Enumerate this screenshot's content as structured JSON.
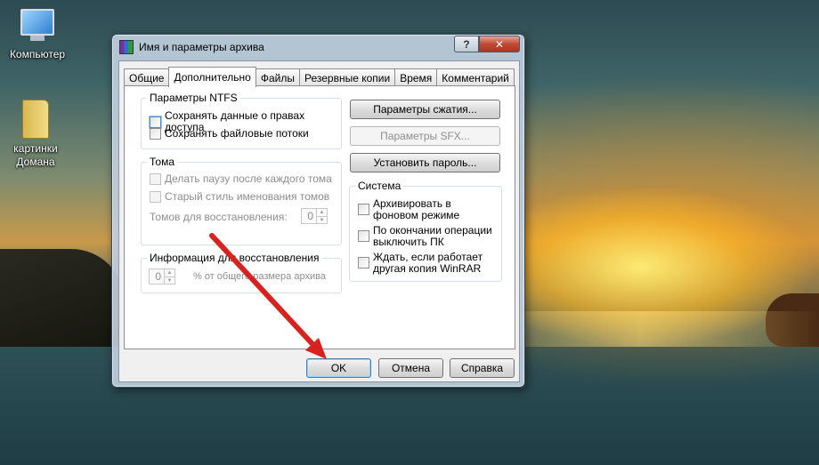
{
  "desktop": {
    "icons": [
      {
        "label": "Компьютер",
        "icon": "computer-icon"
      },
      {
        "label": "картинки Домана",
        "icon": "folder-icon"
      }
    ]
  },
  "dialog": {
    "title": "Имя и параметры архива",
    "help_label": "?",
    "close_label": "✕",
    "tabs": [
      {
        "label": "Общие",
        "active": false
      },
      {
        "label": "Дополнительно",
        "active": true
      },
      {
        "label": "Файлы",
        "active": false
      },
      {
        "label": "Резервные копии",
        "active": false
      },
      {
        "label": "Время",
        "active": false
      },
      {
        "label": "Комментарий",
        "active": false
      }
    ],
    "ntfs": {
      "title": "Параметры NTFS",
      "save_access_rights": "Сохранять данные о правах доступа",
      "save_file_streams": "Сохранять файловые потоки"
    },
    "volumes": {
      "title": "Тома",
      "pause_after_volume": "Делать паузу после каждого тома",
      "old_naming_style": "Старый стиль именования томов",
      "recovery_volumes_label": "Томов для восстановления:",
      "recovery_volumes_value": "0"
    },
    "recovery": {
      "title": "Информация для восстановления",
      "value": "0",
      "unit_label": "% от общего размера архива"
    },
    "buttons": {
      "compression_params": "Параметры сжатия...",
      "sfx_params": "Параметры SFX...",
      "set_password": "Установить пароль..."
    },
    "system": {
      "title": "Система",
      "background_archiving": "Архивировать в фоновом режиме",
      "shutdown_when_done": "По окончании операции выключить ПК",
      "wait_other_copy": "Ждать, если работает другая копия WinRAR"
    },
    "footer": {
      "ok": "OK",
      "cancel": "Отмена",
      "help": "Справка"
    }
  },
  "annotation": {
    "color": "#d8221f"
  }
}
